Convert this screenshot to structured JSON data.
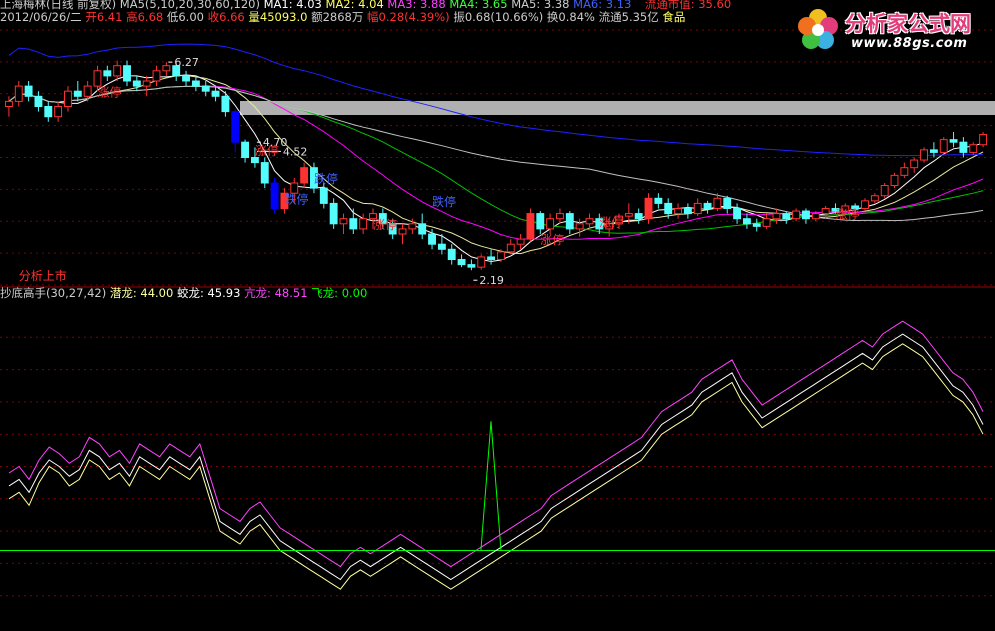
{
  "header": {
    "stock_name": "上海梅林",
    "period": "(日线 前复权)",
    "ma_params": "MA5(5,10,20,30,60,120)",
    "ma1": "MA1: 4.03",
    "ma2": "MA2: 4.04",
    "ma3": "MA3: 3.88",
    "ma4": "MA4: 3.65",
    "ma5": "MA5: 3.38",
    "ma6": "MA6: 3.13",
    "float_mktcap_label": "流通市值: 35.60",
    "date": "2012/06/26/二",
    "open": "开6.41",
    "high": "高6.68",
    "low": "低6.00",
    "close": "收6.66",
    "volume": "量45093.0",
    "amount": "额2868万",
    "change": "幅0.28(4.39%)",
    "amplitude": "振0.68(10.66%)",
    "turnover": "换0.84%",
    "float_cap": "流通5.35亿",
    "sector": "食品"
  },
  "indicator": {
    "name": "抄底高手(30,27,42)",
    "qianlong": "潜龙: 44.00",
    "jiaolong": "蛟龙: 45.93",
    "kanglong": "亢龙: 48.51",
    "feilong": "飞龙: 0.00"
  },
  "logo": {
    "text": "分析家公式网",
    "url": "www.88gs.com"
  },
  "colors": {
    "bg": "#000000",
    "up": "#ff3232",
    "down": "#54fcfc",
    "down_big": "#0000ff",
    "ma_white": "#ffffff",
    "ma_yellow": "#e8e8a0",
    "ma_magenta": "#ff00ff",
    "ma_green": "#00c000",
    "ma_gray": "#c0c0c0",
    "ma_blue": "#2020ff",
    "grid": "#800000",
    "qianlong": "#ffffa0",
    "jiaolong": "#ffffff",
    "kanglong": "#ff44ff",
    "feilong": "#00ff00"
  },
  "chart_data": [
    {
      "type": "candlestick",
      "title": "上海梅林 日线",
      "price_labels": [
        {
          "text": "6.27",
          "value": 6.27
        },
        {
          "text": "4.52",
          "value": 4.52
        },
        {
          "text": "4.70",
          "value": 4.7
        },
        {
          "text": "2.19",
          "value": 2.19
        }
      ],
      "annotations": [
        "分析上市",
        "涨停",
        "涨停",
        "跌停",
        "跌停",
        "涨停",
        "跌停",
        "涨停",
        "涨停",
        "涨停"
      ],
      "ylim": [
        1.9,
        6.9
      ],
      "candles": [
        [
          5.4,
          5.6,
          5.2,
          5.5
        ],
        [
          5.5,
          5.9,
          5.4,
          5.8
        ],
        [
          5.8,
          5.9,
          5.5,
          5.6
        ],
        [
          5.6,
          5.7,
          5.3,
          5.4
        ],
        [
          5.4,
          5.5,
          5.1,
          5.2
        ],
        [
          5.2,
          5.5,
          5.1,
          5.4
        ],
        [
          5.4,
          5.8,
          5.3,
          5.7
        ],
        [
          5.7,
          5.9,
          5.5,
          5.6
        ],
        [
          5.6,
          5.9,
          5.5,
          5.8
        ],
        [
          5.8,
          6.2,
          5.7,
          6.1
        ],
        [
          6.1,
          6.2,
          5.9,
          6.0
        ],
        [
          6.0,
          6.3,
          5.9,
          6.2
        ],
        [
          6.2,
          6.3,
          5.8,
          5.9
        ],
        [
          5.9,
          6.0,
          5.7,
          5.8
        ],
        [
          5.8,
          6.0,
          5.6,
          5.9
        ],
        [
          5.9,
          6.2,
          5.8,
          6.1
        ],
        [
          6.1,
          6.27,
          6.0,
          6.2
        ],
        [
          6.2,
          6.25,
          5.9,
          6.0
        ],
        [
          6.0,
          6.1,
          5.8,
          5.9
        ],
        [
          5.9,
          6.0,
          5.7,
          5.8
        ],
        [
          5.8,
          5.9,
          5.6,
          5.7
        ],
        [
          5.7,
          5.8,
          5.5,
          5.6
        ],
        [
          5.6,
          5.7,
          5.2,
          5.3
        ],
        [
          5.3,
          5.35,
          4.5,
          4.7
        ],
        [
          4.7,
          4.75,
          4.3,
          4.4
        ],
        [
          4.4,
          4.6,
          4.2,
          4.3
        ],
        [
          4.3,
          4.4,
          3.8,
          3.9
        ],
        [
          3.9,
          4.0,
          3.3,
          3.4
        ],
        [
          3.4,
          3.8,
          3.3,
          3.7
        ],
        [
          3.7,
          4.0,
          3.5,
          3.9
        ],
        [
          3.9,
          4.3,
          3.8,
          4.2
        ],
        [
          4.2,
          4.3,
          3.7,
          3.8
        ],
        [
          3.8,
          3.9,
          3.4,
          3.5
        ],
        [
          3.5,
          3.6,
          3.0,
          3.1
        ],
        [
          3.1,
          3.3,
          2.9,
          3.2
        ],
        [
          3.2,
          3.4,
          2.9,
          3.0
        ],
        [
          3.0,
          3.3,
          2.9,
          3.2
        ],
        [
          3.2,
          3.4,
          3.0,
          3.3
        ],
        [
          3.3,
          3.4,
          3.0,
          3.1
        ],
        [
          3.1,
          3.2,
          2.8,
          2.9
        ],
        [
          2.9,
          3.1,
          2.7,
          3.0
        ],
        [
          3.0,
          3.2,
          2.9,
          3.1
        ],
        [
          3.1,
          3.3,
          2.8,
          2.9
        ],
        [
          2.9,
          3.0,
          2.6,
          2.7
        ],
        [
          2.7,
          2.9,
          2.5,
          2.6
        ],
        [
          2.6,
          2.7,
          2.3,
          2.4
        ],
        [
          2.4,
          2.5,
          2.25,
          2.3
        ],
        [
          2.3,
          2.4,
          2.19,
          2.25
        ],
        [
          2.25,
          2.5,
          2.2,
          2.45
        ],
        [
          2.45,
          2.6,
          2.3,
          2.4
        ],
        [
          2.4,
          2.6,
          2.35,
          2.55
        ],
        [
          2.55,
          2.8,
          2.5,
          2.7
        ],
        [
          2.7,
          2.9,
          2.6,
          2.8
        ],
        [
          2.8,
          3.4,
          2.75,
          3.3
        ],
        [
          3.3,
          3.35,
          2.9,
          3.0
        ],
        [
          3.0,
          3.3,
          2.9,
          3.2
        ],
        [
          3.2,
          3.4,
          3.1,
          3.3
        ],
        [
          3.3,
          3.35,
          2.9,
          3.0
        ],
        [
          3.0,
          3.2,
          2.85,
          3.1
        ],
        [
          3.1,
          3.3,
          3.0,
          3.2
        ],
        [
          3.2,
          3.3,
          2.9,
          3.0
        ],
        [
          3.0,
          3.2,
          2.85,
          3.1
        ],
        [
          3.1,
          3.3,
          3.0,
          3.25
        ],
        [
          3.25,
          3.5,
          3.1,
          3.3
        ],
        [
          3.3,
          3.4,
          3.1,
          3.2
        ],
        [
          3.2,
          3.7,
          3.1,
          3.6
        ],
        [
          3.6,
          3.7,
          3.4,
          3.5
        ],
        [
          3.5,
          3.6,
          3.2,
          3.3
        ],
        [
          3.3,
          3.5,
          3.2,
          3.4
        ],
        [
          3.4,
          3.5,
          3.2,
          3.3
        ],
        [
          3.3,
          3.6,
          3.25,
          3.5
        ],
        [
          3.5,
          3.55,
          3.3,
          3.4
        ],
        [
          3.4,
          3.7,
          3.35,
          3.6
        ],
        [
          3.6,
          3.65,
          3.3,
          3.4
        ],
        [
          3.4,
          3.5,
          3.1,
          3.2
        ],
        [
          3.2,
          3.3,
          3.0,
          3.1
        ],
        [
          3.1,
          3.2,
          2.95,
          3.05
        ],
        [
          3.05,
          3.3,
          3.0,
          3.2
        ],
        [
          3.2,
          3.4,
          3.1,
          3.3
        ],
        [
          3.3,
          3.35,
          3.1,
          3.2
        ],
        [
          3.2,
          3.4,
          3.15,
          3.35
        ],
        [
          3.35,
          3.4,
          3.1,
          3.2
        ],
        [
          3.2,
          3.35,
          3.15,
          3.3
        ],
        [
          3.3,
          3.45,
          3.2,
          3.4
        ],
        [
          3.4,
          3.5,
          3.3,
          3.35
        ],
        [
          3.35,
          3.5,
          3.3,
          3.45
        ],
        [
          3.45,
          3.5,
          3.3,
          3.4
        ],
        [
          3.4,
          3.6,
          3.35,
          3.55
        ],
        [
          3.55,
          3.7,
          3.5,
          3.65
        ],
        [
          3.65,
          3.9,
          3.6,
          3.85
        ],
        [
          3.85,
          4.1,
          3.8,
          4.05
        ],
        [
          4.05,
          4.3,
          4.0,
          4.2
        ],
        [
          4.2,
          4.4,
          4.1,
          4.35
        ],
        [
          4.35,
          4.6,
          4.3,
          4.55
        ],
        [
          4.55,
          4.7,
          4.4,
          4.5
        ],
        [
          4.5,
          4.8,
          4.45,
          4.75
        ],
        [
          4.75,
          4.9,
          4.6,
          4.7
        ],
        [
          4.7,
          4.8,
          4.4,
          4.5
        ],
        [
          4.5,
          4.7,
          4.45,
          4.65
        ],
        [
          4.65,
          4.9,
          4.6,
          4.85
        ]
      ]
    },
    {
      "type": "line",
      "title": "抄底高手(30,27,42)",
      "ylim": [
        0,
        100
      ],
      "series": [
        {
          "name": "潜龙",
          "values": [
            40,
            42,
            38,
            45,
            50,
            48,
            44,
            46,
            52,
            50,
            46,
            48,
            44,
            50,
            48,
            46,
            50,
            48,
            46,
            50,
            40,
            30,
            28,
            26,
            30,
            32,
            28,
            24,
            22,
            20,
            18,
            16,
            14,
            12,
            16,
            18,
            16,
            18,
            20,
            22,
            20,
            18,
            16,
            14,
            12,
            14,
            16,
            18,
            20,
            22,
            24,
            26,
            28,
            30,
            34,
            36,
            38,
            40,
            42,
            44,
            46,
            48,
            50,
            52,
            56,
            60,
            62,
            64,
            66,
            70,
            72,
            74,
            76,
            70,
            66,
            62,
            64,
            66,
            68,
            70,
            72,
            74,
            76,
            78,
            80,
            82,
            80,
            84,
            86,
            88,
            86,
            84,
            80,
            76,
            72,
            70,
            66,
            60
          ]
        },
        {
          "name": "蛟龙",
          "values": [
            44,
            46,
            42,
            48,
            52,
            50,
            47,
            49,
            55,
            53,
            49,
            51,
            47,
            53,
            51,
            49,
            53,
            51,
            49,
            53,
            43,
            33,
            31,
            29,
            33,
            35,
            31,
            27,
            25,
            23,
            21,
            19,
            17,
            15,
            19,
            21,
            19,
            21,
            23,
            25,
            23,
            21,
            19,
            17,
            15,
            17,
            19,
            21,
            23,
            25,
            27,
            29,
            31,
            33,
            37,
            39,
            41,
            43,
            45,
            47,
            49,
            51,
            53,
            55,
            59,
            63,
            65,
            67,
            69,
            73,
            75,
            77,
            79,
            73,
            69,
            65,
            67,
            69,
            71,
            73,
            75,
            77,
            79,
            81,
            83,
            85,
            83,
            87,
            89,
            91,
            89,
            87,
            83,
            79,
            75,
            73,
            69,
            63
          ]
        },
        {
          "name": "亢龙",
          "values": [
            48,
            50,
            46,
            52,
            56,
            54,
            51,
            53,
            59,
            57,
            53,
            55,
            51,
            57,
            55,
            53,
            57,
            55,
            53,
            57,
            47,
            37,
            35,
            33,
            37,
            39,
            35,
            31,
            29,
            27,
            25,
            23,
            21,
            19,
            23,
            25,
            23,
            25,
            27,
            29,
            27,
            25,
            23,
            21,
            19,
            21,
            23,
            25,
            27,
            29,
            31,
            33,
            35,
            37,
            41,
            43,
            45,
            47,
            49,
            51,
            53,
            55,
            57,
            59,
            63,
            67,
            69,
            71,
            73,
            77,
            79,
            81,
            83,
            77,
            73,
            69,
            71,
            73,
            75,
            77,
            79,
            81,
            83,
            85,
            87,
            89,
            87,
            91,
            93,
            95,
            93,
            91,
            87,
            83,
            79,
            77,
            73,
            67
          ]
        },
        {
          "name": "飞龙",
          "values": [
            0,
            0,
            0,
            0,
            0,
            0,
            0,
            0,
            0,
            0,
            0,
            0,
            0,
            0,
            0,
            0,
            0,
            0,
            0,
            0,
            0,
            0,
            0,
            0,
            0,
            0,
            0,
            0,
            0,
            0,
            0,
            0,
            0,
            0,
            0,
            0,
            0,
            0,
            0,
            0,
            0,
            0,
            0,
            0,
            0,
            0,
            0,
            0,
            100,
            0,
            0,
            0,
            0,
            0,
            0,
            0,
            0,
            0,
            0,
            0,
            0,
            0,
            0,
            0,
            0,
            0,
            0,
            0,
            0,
            0,
            0,
            0,
            0,
            0,
            0,
            0,
            0,
            0,
            0,
            0,
            0,
            0,
            0,
            0,
            0,
            0,
            0,
            0,
            0,
            0,
            0,
            0,
            0,
            0,
            0,
            0,
            0,
            0
          ]
        }
      ]
    }
  ]
}
